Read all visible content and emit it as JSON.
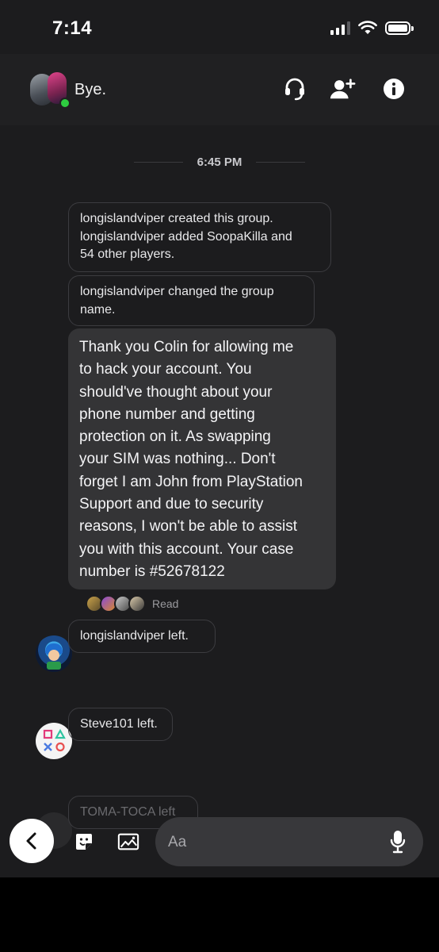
{
  "status_bar": {
    "time": "7:14"
  },
  "header": {
    "title": "Bye.",
    "icons": [
      "group-avatar",
      "headset-icon",
      "add-user-icon",
      "info-icon"
    ]
  },
  "chat": {
    "time_separator": "6:45 PM",
    "system_messages": [
      {
        "lines": [
          "longislandviper created this group.",
          "longislandviper added SoopaKilla and",
          "54 other players."
        ]
      },
      {
        "lines": [
          "longislandviper changed the group",
          "name."
        ]
      }
    ],
    "message": {
      "lines": [
        "Thank you Colin for allowing me",
        "to hack your account. You",
        "should've thought about your",
        "phone number and getting",
        "protection on it. As swapping",
        "your SIM was nothing... Don't",
        "forget I am John from PlayStation",
        "Support and due to security",
        "reasons, I won't be able to assist",
        "you with this account. Your case",
        "number is #52678122"
      ]
    },
    "read_receipt": "Read",
    "events": [
      {
        "text": "longislandviper left."
      },
      {
        "text": "Steve101 left."
      },
      {
        "text": "TOMA-TOCA left"
      }
    ]
  },
  "input_bar": {
    "placeholder": "Aa",
    "icons": [
      "back-icon",
      "sticker-icon",
      "image-icon",
      "mic-icon"
    ]
  },
  "colors": {
    "background": "#1c1c1e",
    "header": "#202022",
    "bubble": "#343436",
    "online": "#2ecc40"
  }
}
